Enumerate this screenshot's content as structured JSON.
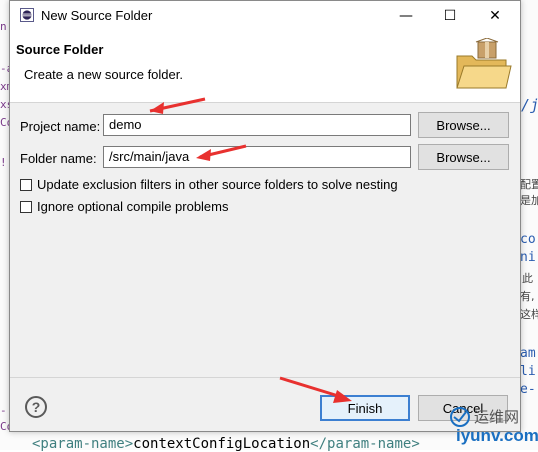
{
  "dialog": {
    "title": "New Source Folder",
    "header_title": "Source Folder",
    "header_description": "Create a new source folder.",
    "window_buttons": {
      "minimize": "—",
      "maximize": "☐",
      "close": "✕"
    }
  },
  "form": {
    "project_label": "Project name:",
    "project_value": "demo",
    "folder_label": "Folder name:",
    "folder_value": "/src/main/java",
    "browse_label": "Browse...",
    "check_update_label": "Update exclusion filters in other source folders to solve nesting",
    "check_ignore_label": "Ignore optional compile problems"
  },
  "buttons": {
    "help": "?",
    "finish": "Finish",
    "cancel": "Cancel"
  },
  "background_editor": {
    "bottom_line_open_tag": "<param-name>",
    "bottom_line_text": "contextConfigLocation",
    "bottom_line_close_tag": "</param-name>"
  },
  "watermark": {
    "cn_text": "运维网",
    "domain": "iyunv.com"
  },
  "colors": {
    "accent": "#3c7fd1",
    "annotation_red": "#e8312f"
  }
}
